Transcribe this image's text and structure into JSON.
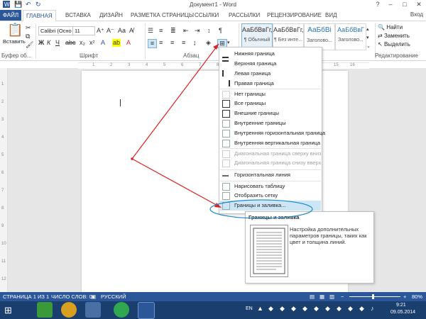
{
  "window": {
    "title": "Документ1 - Word",
    "sign_in": "Вход",
    "ribbon_tabs": [
      "ФАЙЛ",
      "ГЛАВНАЯ",
      "ВСТАВКА",
      "ДИЗАЙН",
      "РАЗМЕТКА СТРАНИЦЫ",
      "ССЫЛКИ",
      "РАССЫЛКИ",
      "РЕЦЕНЗИРОВАНИЕ",
      "ВИД"
    ],
    "active_tab": "ГЛАВНАЯ"
  },
  "ribbon": {
    "clipboard": {
      "paste_label": "Вставить",
      "group_label": "Буфер об..."
    },
    "font": {
      "font_name": "Calibri (Осно",
      "font_size": "11",
      "group_label": "Шрифт"
    },
    "paragraph": {
      "group_label": "Абзац"
    },
    "styles": [
      {
        "sample": "АаБбВвГг,",
        "name": "¶ Обычный"
      },
      {
        "sample": "АаБбВвГг,",
        "name": "¶ Без инте..."
      },
      {
        "sample": "АаБбВі",
        "name": "Заголово..."
      },
      {
        "sample": "АаБбВвГ",
        "name": "Заголово..."
      }
    ],
    "editing": {
      "find": "Найти",
      "replace": "Заменить",
      "select": "Выделить",
      "group_label": "Редактирование"
    }
  },
  "ruler": {
    "marks": [
      "1",
      "2",
      "3",
      "4",
      "5",
      "6",
      "7",
      "8",
      "9",
      "10",
      "11",
      "12",
      "13",
      "14",
      "15",
      "16"
    ]
  },
  "vruler": {
    "marks": [
      "1",
      "2",
      "3",
      "4",
      "5",
      "6",
      "7",
      "8",
      "9",
      "10",
      "11",
      "12"
    ]
  },
  "borders_menu": {
    "items": [
      {
        "label": "Нижняя граница",
        "disabled": false
      },
      {
        "label": "Верхняя граница",
        "disabled": false
      },
      {
        "label": "Левая граница",
        "disabled": false
      },
      {
        "label": "Правая граница",
        "disabled": false
      },
      {
        "label": "Нет границы",
        "disabled": false
      },
      {
        "label": "Все границы",
        "disabled": false
      },
      {
        "label": "Внешние границы",
        "disabled": false
      },
      {
        "label": "Внутренние границы",
        "disabled": false
      },
      {
        "label": "Внутренняя горизонтальная граница",
        "disabled": false
      },
      {
        "label": "Внутренняя вертикальная граница",
        "disabled": false
      },
      {
        "label": "Диагональная граница сверху вниз",
        "disabled": true
      },
      {
        "label": "Диагональная граница снизу вверх",
        "disabled": true
      },
      {
        "label": "Горизонтальная линия",
        "disabled": false
      },
      {
        "label": "Нарисовать таблицу",
        "disabled": false
      },
      {
        "label": "Отобразить сетку",
        "disabled": false
      },
      {
        "label": "Границы и заливка...",
        "disabled": false
      }
    ]
  },
  "tooltip": {
    "title": "Границы и заливка",
    "text": "Настройка дополнительных параметров границы, таких как цвет и толщина линий."
  },
  "status": {
    "page": "СТРАНИЦА 1 ИЗ 1",
    "words": "ЧИСЛО СЛОВ: 0",
    "language": "РУССКИЙ",
    "zoom": "80%"
  },
  "taskbar": {
    "lang": "EN",
    "time": "9:21",
    "date": "09.05.2014"
  },
  "colors": {
    "accent": "#2b579a",
    "annotation": "#e02020",
    "highlight": "#cde6f7"
  }
}
